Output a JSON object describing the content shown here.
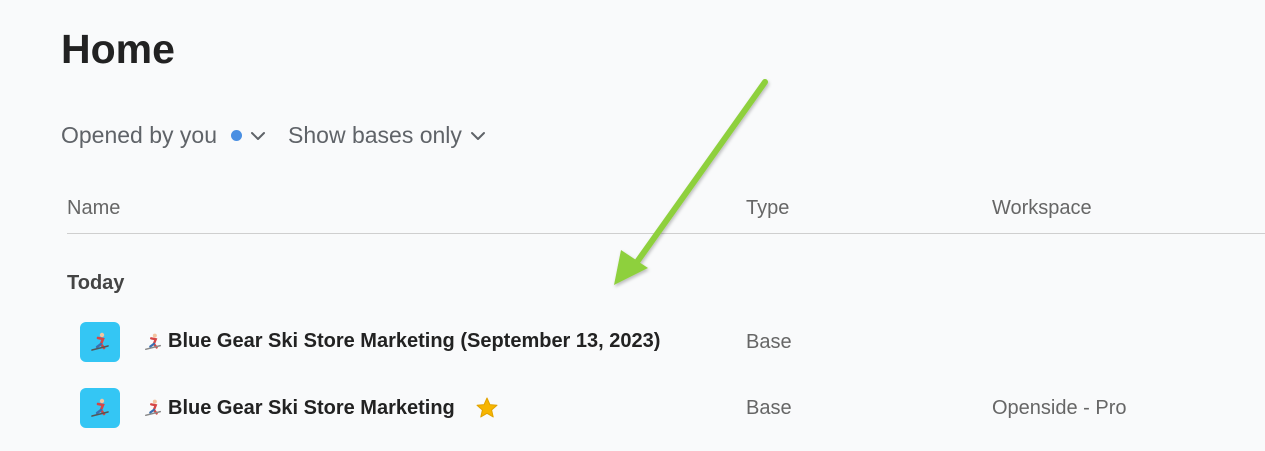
{
  "page": {
    "title": "Home"
  },
  "filters": {
    "opened_by": "Opened by you",
    "show_bases": "Show bases only"
  },
  "columns": {
    "name": "Name",
    "type": "Type",
    "workspace": "Workspace"
  },
  "groups": [
    {
      "label": "Today",
      "rows": [
        {
          "name": "Blue Gear Ski Store Marketing (September 13, 2023)",
          "type": "Base",
          "workspace": "",
          "starred": false
        },
        {
          "name": "Blue Gear Ski Store Marketing",
          "type": "Base",
          "workspace": "Openside - Pro",
          "starred": true
        }
      ]
    }
  ],
  "icons": {
    "opened_by_indicator": "blue-dot-icon",
    "dropdown": "chevron-down-icon",
    "app": "skier-icon",
    "emoji": "skier-emoji-icon",
    "star": "star-icon",
    "annotation": "green-arrow-icon"
  },
  "colors": {
    "indicator_dot": "#4a8fe2",
    "app_icon_bg": "#34c6f4",
    "star": "#f7b500",
    "annotation_arrow": "#8ed03c"
  }
}
